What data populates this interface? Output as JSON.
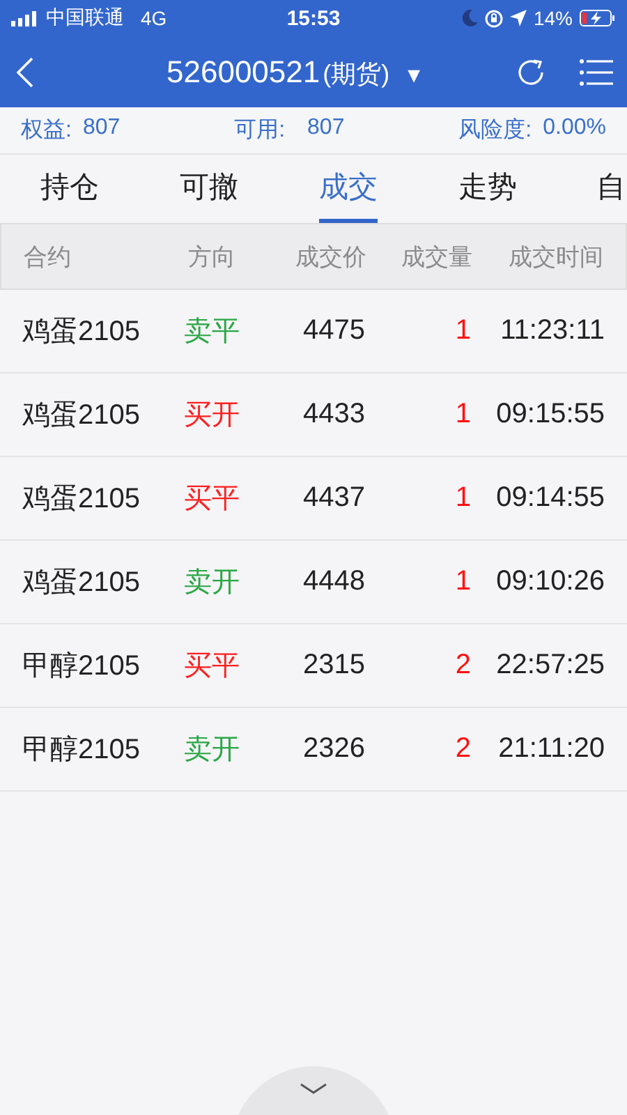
{
  "status_bar": {
    "carrier": "中国联通",
    "network": "4G",
    "time": "15:53",
    "battery": "14%"
  },
  "header": {
    "title": "526000521",
    "subtitle": "(期货)",
    "dropdown": "▼"
  },
  "account": [
    {
      "label": "权益:",
      "value": "807"
    },
    {
      "label": "可用:",
      "value": "807"
    },
    {
      "label": "风险度:",
      "value": "0.00%"
    }
  ],
  "tabs": [
    {
      "label": "持仓",
      "selected": false
    },
    {
      "label": "可撤",
      "selected": false
    },
    {
      "label": "成交",
      "selected": true
    },
    {
      "label": "走势",
      "selected": false
    },
    {
      "label": "自",
      "selected": false
    }
  ],
  "table": {
    "columns": [
      "合约",
      "方向",
      "成交价",
      "成交量",
      "成交时间"
    ],
    "rows": [
      {
        "contract": "鸡蛋2105",
        "direction": "卖平",
        "color": "#2aa745",
        "price": "4475",
        "volume": "1",
        "time": "11:23:11"
      },
      {
        "contract": "鸡蛋2105",
        "direction": "买开",
        "color": "#ff2020",
        "price": "4433",
        "volume": "1",
        "time": "09:15:55"
      },
      {
        "contract": "鸡蛋2105",
        "direction": "买平",
        "color": "#ff2020",
        "price": "4437",
        "volume": "1",
        "time": "09:14:55"
      },
      {
        "contract": "鸡蛋2105",
        "direction": "卖开",
        "color": "#2aa745",
        "price": "4448",
        "volume": "1",
        "time": "09:10:26"
      },
      {
        "contract": "甲醇2105",
        "direction": "买平",
        "color": "#ff2020",
        "price": "2315",
        "volume": "2",
        "time": "22:57:25"
      },
      {
        "contract": "甲醇2105",
        "direction": "卖开",
        "color": "#2aa745",
        "price": "2326",
        "volume": "2",
        "time": "21:11:20"
      }
    ]
  }
}
